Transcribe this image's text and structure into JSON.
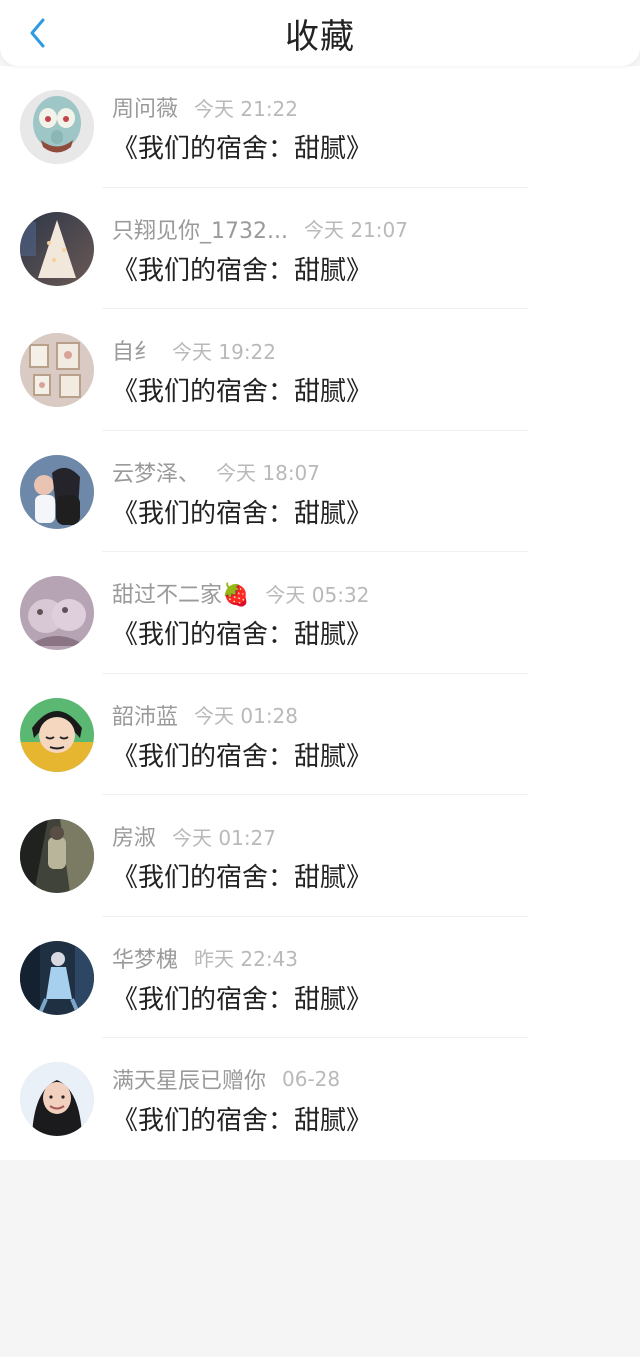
{
  "header": {
    "title": "收藏",
    "back_icon": "chevron-left-icon",
    "accent_color": "#2e9ae3"
  },
  "items": [
    {
      "name": "周问薇",
      "time": "今天 21:22",
      "text": "《我们的宿舍：甜腻》"
    },
    {
      "name": "只翔见你_1732...",
      "time": "今天 21:07",
      "text": "《我们的宿舍：甜腻》"
    },
    {
      "name": "自纟",
      "time": "今天 19:22",
      "text": "《我们的宿舍：甜腻》"
    },
    {
      "name": "云梦泽、",
      "time": "今天 18:07",
      "text": "《我们的宿舍：甜腻》"
    },
    {
      "name": "甜过不二家🍓",
      "time": "今天 05:32",
      "text": "《我们的宿舍：甜腻》"
    },
    {
      "name": "韶沛蓝",
      "time": "今天 01:28",
      "text": "《我们的宿舍：甜腻》"
    },
    {
      "name": "房淑",
      "time": "今天 01:27",
      "text": "《我们的宿舍：甜腻》"
    },
    {
      "name": "华梦槐",
      "time": "昨天 22:43",
      "text": "《我们的宿舍：甜腻》"
    },
    {
      "name": "满天星辰已赠你",
      "time": "06-28",
      "text": "《我们的宿舍：甜腻》"
    }
  ]
}
